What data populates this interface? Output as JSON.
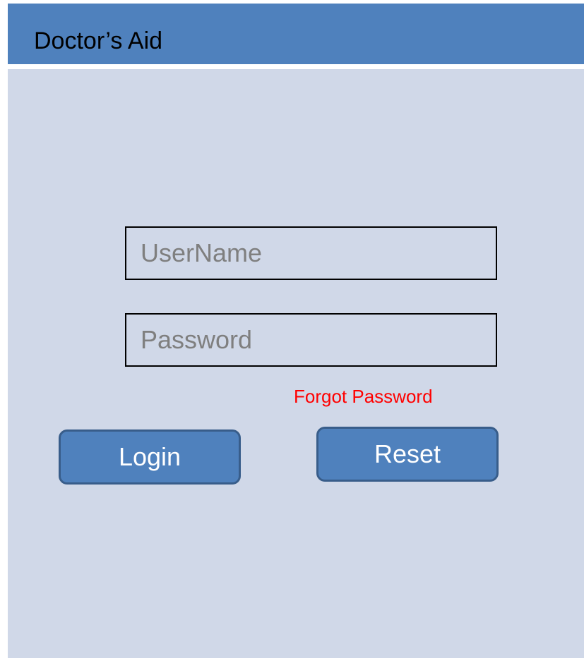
{
  "app": {
    "title": "Doctor’s Aid"
  },
  "login_form": {
    "username": {
      "placeholder": "UserName",
      "value": ""
    },
    "password": {
      "placeholder": "Password",
      "value": ""
    },
    "forgot_password_label": "Forgot Password",
    "login_label": "Login",
    "reset_label": "Reset"
  },
  "colors": {
    "header_background": "#4f81bd",
    "content_background": "#d0d8e8",
    "button_fill": "#4f81bd",
    "button_border": "#385d8a",
    "button_text": "#ffffff",
    "placeholder_text": "#7f7f7f",
    "forgot_link": "#ff0000"
  }
}
